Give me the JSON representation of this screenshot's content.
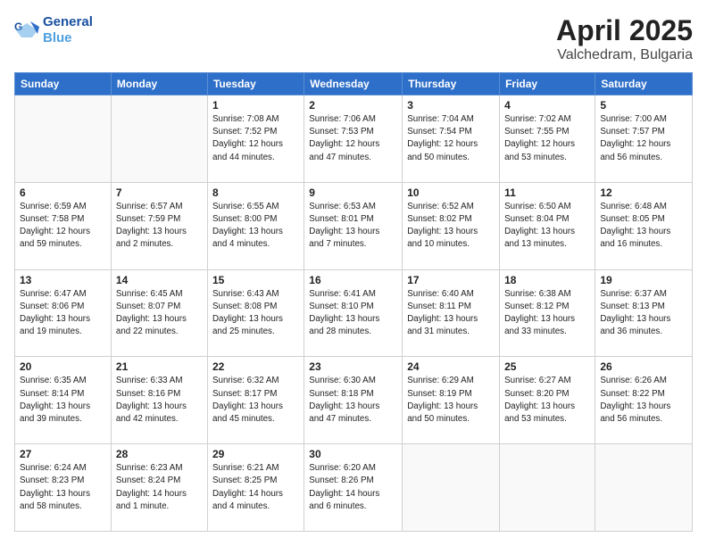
{
  "header": {
    "logo_line1": "General",
    "logo_line2": "Blue",
    "month": "April 2025",
    "location": "Valchedram, Bulgaria"
  },
  "days_of_week": [
    "Sunday",
    "Monday",
    "Tuesday",
    "Wednesday",
    "Thursday",
    "Friday",
    "Saturday"
  ],
  "weeks": [
    [
      {
        "day": "",
        "info": ""
      },
      {
        "day": "",
        "info": ""
      },
      {
        "day": "1",
        "info": "Sunrise: 7:08 AM\nSunset: 7:52 PM\nDaylight: 12 hours\nand 44 minutes."
      },
      {
        "day": "2",
        "info": "Sunrise: 7:06 AM\nSunset: 7:53 PM\nDaylight: 12 hours\nand 47 minutes."
      },
      {
        "day": "3",
        "info": "Sunrise: 7:04 AM\nSunset: 7:54 PM\nDaylight: 12 hours\nand 50 minutes."
      },
      {
        "day": "4",
        "info": "Sunrise: 7:02 AM\nSunset: 7:55 PM\nDaylight: 12 hours\nand 53 minutes."
      },
      {
        "day": "5",
        "info": "Sunrise: 7:00 AM\nSunset: 7:57 PM\nDaylight: 12 hours\nand 56 minutes."
      }
    ],
    [
      {
        "day": "6",
        "info": "Sunrise: 6:59 AM\nSunset: 7:58 PM\nDaylight: 12 hours\nand 59 minutes."
      },
      {
        "day": "7",
        "info": "Sunrise: 6:57 AM\nSunset: 7:59 PM\nDaylight: 13 hours\nand 2 minutes."
      },
      {
        "day": "8",
        "info": "Sunrise: 6:55 AM\nSunset: 8:00 PM\nDaylight: 13 hours\nand 4 minutes."
      },
      {
        "day": "9",
        "info": "Sunrise: 6:53 AM\nSunset: 8:01 PM\nDaylight: 13 hours\nand 7 minutes."
      },
      {
        "day": "10",
        "info": "Sunrise: 6:52 AM\nSunset: 8:02 PM\nDaylight: 13 hours\nand 10 minutes."
      },
      {
        "day": "11",
        "info": "Sunrise: 6:50 AM\nSunset: 8:04 PM\nDaylight: 13 hours\nand 13 minutes."
      },
      {
        "day": "12",
        "info": "Sunrise: 6:48 AM\nSunset: 8:05 PM\nDaylight: 13 hours\nand 16 minutes."
      }
    ],
    [
      {
        "day": "13",
        "info": "Sunrise: 6:47 AM\nSunset: 8:06 PM\nDaylight: 13 hours\nand 19 minutes."
      },
      {
        "day": "14",
        "info": "Sunrise: 6:45 AM\nSunset: 8:07 PM\nDaylight: 13 hours\nand 22 minutes."
      },
      {
        "day": "15",
        "info": "Sunrise: 6:43 AM\nSunset: 8:08 PM\nDaylight: 13 hours\nand 25 minutes."
      },
      {
        "day": "16",
        "info": "Sunrise: 6:41 AM\nSunset: 8:10 PM\nDaylight: 13 hours\nand 28 minutes."
      },
      {
        "day": "17",
        "info": "Sunrise: 6:40 AM\nSunset: 8:11 PM\nDaylight: 13 hours\nand 31 minutes."
      },
      {
        "day": "18",
        "info": "Sunrise: 6:38 AM\nSunset: 8:12 PM\nDaylight: 13 hours\nand 33 minutes."
      },
      {
        "day": "19",
        "info": "Sunrise: 6:37 AM\nSunset: 8:13 PM\nDaylight: 13 hours\nand 36 minutes."
      }
    ],
    [
      {
        "day": "20",
        "info": "Sunrise: 6:35 AM\nSunset: 8:14 PM\nDaylight: 13 hours\nand 39 minutes."
      },
      {
        "day": "21",
        "info": "Sunrise: 6:33 AM\nSunset: 8:16 PM\nDaylight: 13 hours\nand 42 minutes."
      },
      {
        "day": "22",
        "info": "Sunrise: 6:32 AM\nSunset: 8:17 PM\nDaylight: 13 hours\nand 45 minutes."
      },
      {
        "day": "23",
        "info": "Sunrise: 6:30 AM\nSunset: 8:18 PM\nDaylight: 13 hours\nand 47 minutes."
      },
      {
        "day": "24",
        "info": "Sunrise: 6:29 AM\nSunset: 8:19 PM\nDaylight: 13 hours\nand 50 minutes."
      },
      {
        "day": "25",
        "info": "Sunrise: 6:27 AM\nSunset: 8:20 PM\nDaylight: 13 hours\nand 53 minutes."
      },
      {
        "day": "26",
        "info": "Sunrise: 6:26 AM\nSunset: 8:22 PM\nDaylight: 13 hours\nand 56 minutes."
      }
    ],
    [
      {
        "day": "27",
        "info": "Sunrise: 6:24 AM\nSunset: 8:23 PM\nDaylight: 13 hours\nand 58 minutes."
      },
      {
        "day": "28",
        "info": "Sunrise: 6:23 AM\nSunset: 8:24 PM\nDaylight: 14 hours\nand 1 minute."
      },
      {
        "day": "29",
        "info": "Sunrise: 6:21 AM\nSunset: 8:25 PM\nDaylight: 14 hours\nand 4 minutes."
      },
      {
        "day": "30",
        "info": "Sunrise: 6:20 AM\nSunset: 8:26 PM\nDaylight: 14 hours\nand 6 minutes."
      },
      {
        "day": "",
        "info": ""
      },
      {
        "day": "",
        "info": ""
      },
      {
        "day": "",
        "info": ""
      }
    ]
  ]
}
